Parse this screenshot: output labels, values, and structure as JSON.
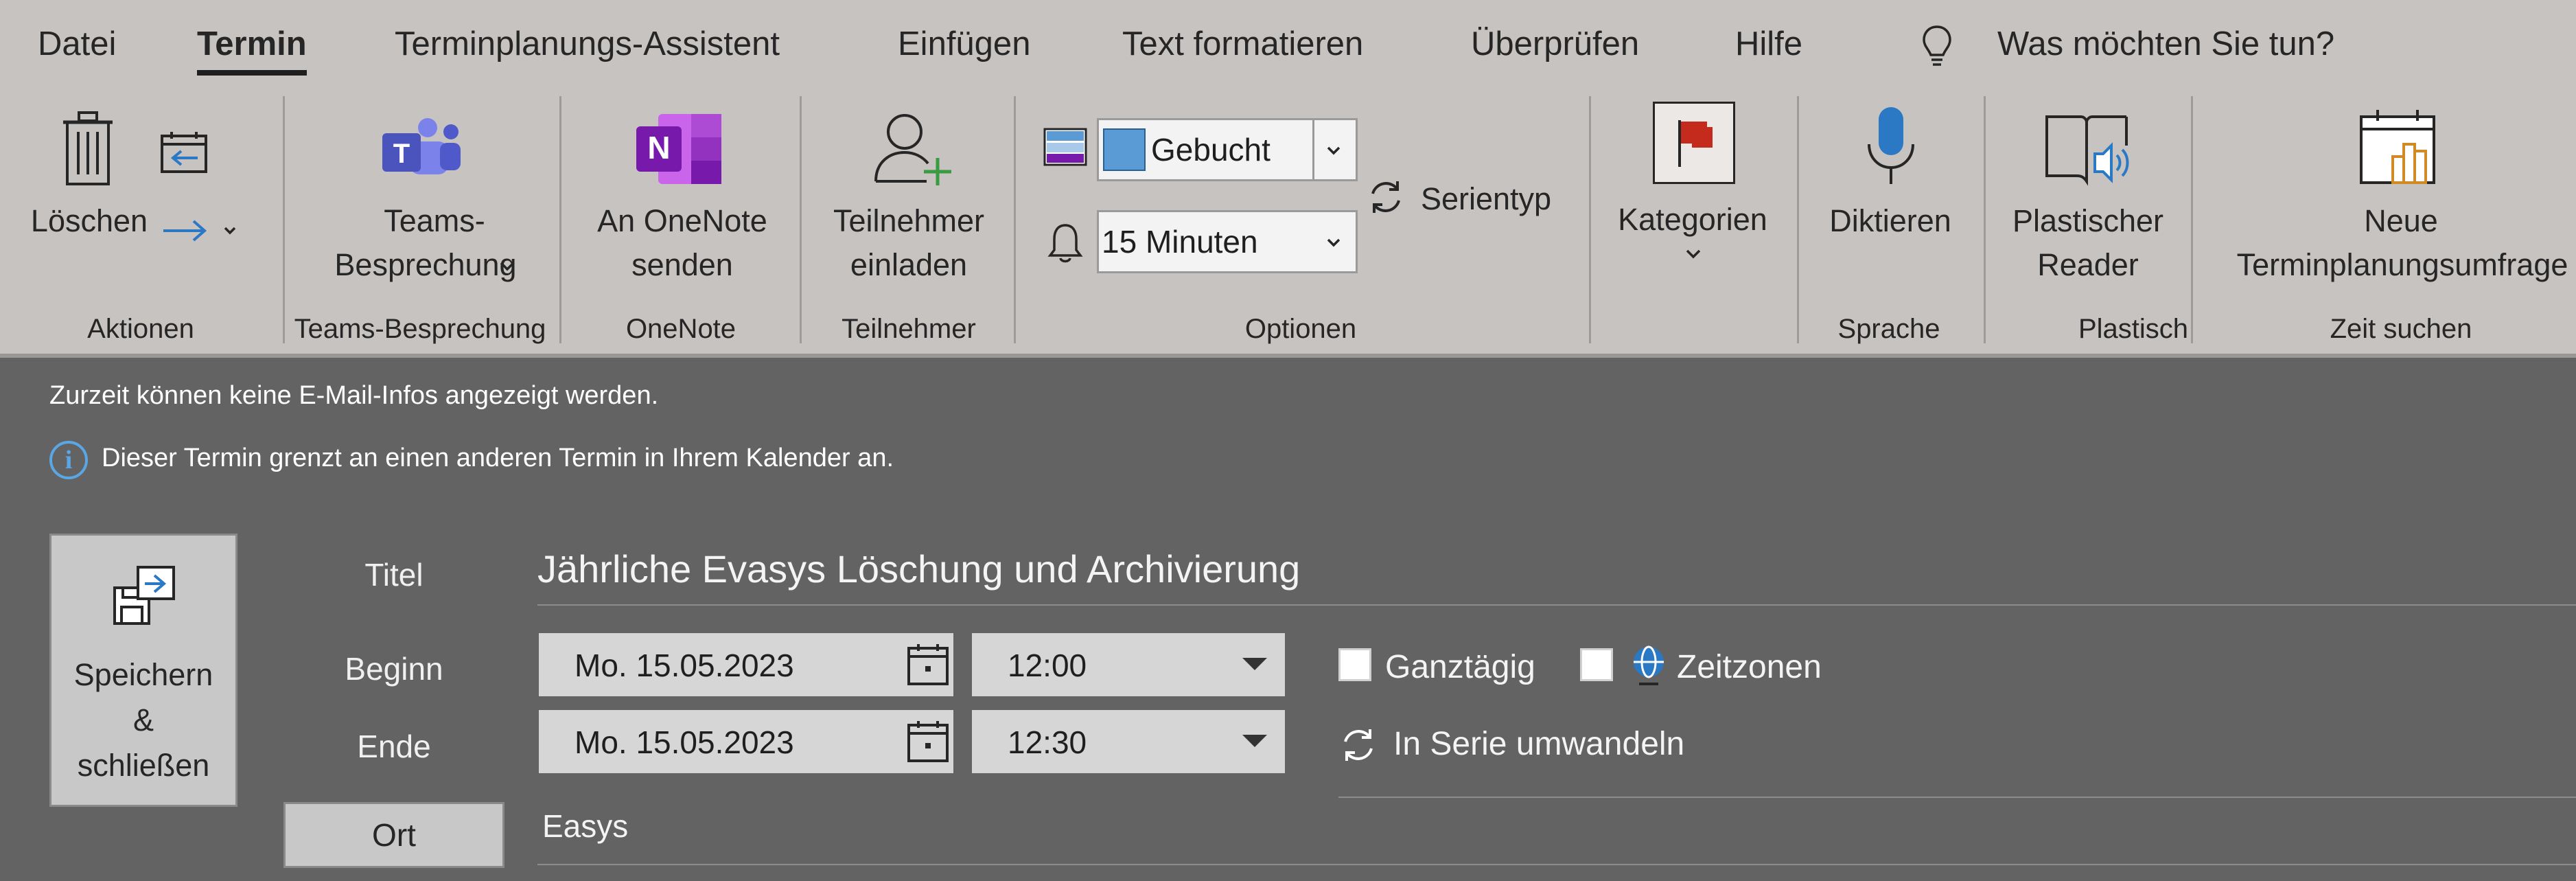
{
  "menu": {
    "tabs": [
      "Datei",
      "Termin",
      "Terminplanungs-Assistent",
      "Einfügen",
      "Text formatieren",
      "Überprüfen",
      "Hilfe"
    ],
    "active_tab": "Termin",
    "tell_me": "Was möchten Sie tun?"
  },
  "ribbon": {
    "aktionen": {
      "delete_label": "Löschen",
      "group_label": "Aktionen"
    },
    "teams": {
      "label_line1": "Teams-",
      "label_line2": "Besprechung",
      "group_label": "Teams-Besprechung"
    },
    "onenote": {
      "label_line1": "An OneNote",
      "label_line2": "senden",
      "group_label": "OneNote"
    },
    "teilnehmer": {
      "label_line1": "Teilnehmer",
      "label_line2": "einladen",
      "group_label": "Teilnehmer"
    },
    "optionen": {
      "show_as": "Gebucht",
      "reminder": "15 Minuten",
      "recurrence_label": "Serientyp",
      "group_label": "Optionen"
    },
    "kategorien": {
      "label": "Kategorien"
    },
    "sprache": {
      "label": "Diktieren",
      "group_label": "Sprache"
    },
    "plastisch": {
      "label_line1": "Plastischer",
      "label_line2": "Reader",
      "group_label": "Plastisch"
    },
    "zeit": {
      "label_line1": "Neue",
      "label_line2": "Terminplanungsumfrage",
      "group_label": "Zeit suchen"
    }
  },
  "info": {
    "mail_tips": "Zurzeit können keine E-Mail-Infos angezeigt werden.",
    "adjacent": "Dieser Termin grenzt an einen anderen Termin in Ihrem Kalender an."
  },
  "form": {
    "save": {
      "line1": "Speichern",
      "line2": "&",
      "line3": "schließen"
    },
    "title_label": "Titel",
    "title_value": "Jährliche Evasys Löschung und Archivierung",
    "start_label": "Beginn",
    "start_date": "Mo. 15.05.2023",
    "start_time": "12:00",
    "end_label": "Ende",
    "end_date": "Mo. 15.05.2023",
    "end_time": "12:30",
    "all_day_label": "Ganztägig",
    "time_zones_label": "Zeitzonen",
    "make_recurring": "In Serie umwandeln",
    "location_button": "Ort",
    "location_value": "Easys"
  },
  "colors": {
    "ribbon_bg": "#c7c3c1",
    "body_bg": "#636363",
    "info_blue": "#5ba7e6",
    "teams_purple": "#5059c9",
    "onenote_purple": "#7719aa",
    "show_as_blue": "#5b9bd5",
    "category_red": "#c42b1c"
  }
}
